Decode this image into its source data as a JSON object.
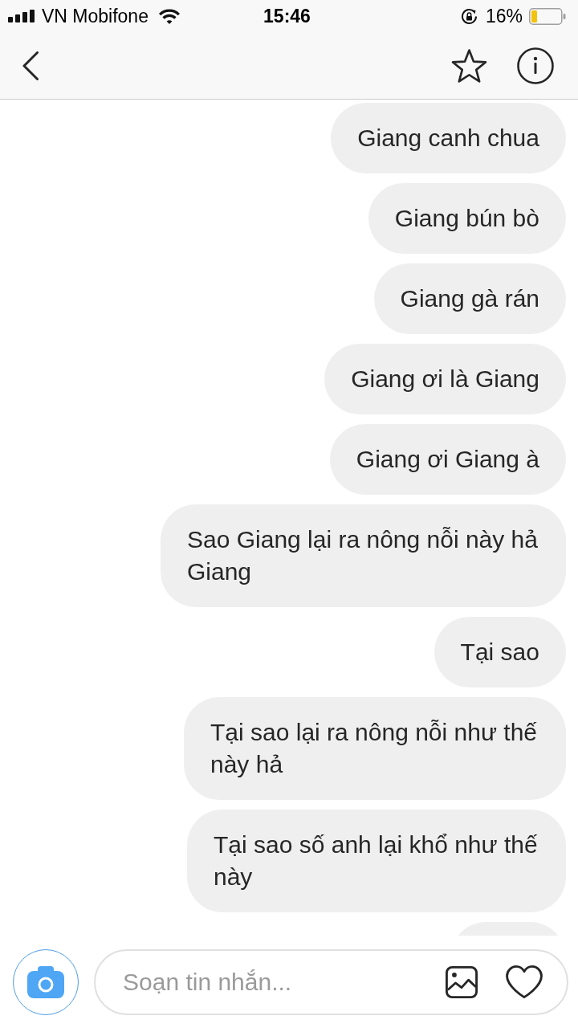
{
  "status_bar": {
    "carrier": "VN Mobifone",
    "time": "15:46",
    "battery_percent": "16%"
  },
  "messages": [
    {
      "kind": "text",
      "text": "Giang canh chua"
    },
    {
      "kind": "text",
      "text": "Giang bún bò"
    },
    {
      "kind": "text",
      "text": "Giang gà rán"
    },
    {
      "kind": "text",
      "text": "Giang ơi là Giang"
    },
    {
      "kind": "text",
      "text": "Giang ơi Giang à"
    },
    {
      "kind": "text",
      "text": "Sao Giang lại ra nông nỗi này hả Giang"
    },
    {
      "kind": "text",
      "text": "Tại sao"
    },
    {
      "kind": "text",
      "text": "Tại sao lại ra nông nỗi như thế này hả"
    },
    {
      "kind": "text",
      "text": "Tại sao số anh lại khổ như thế này"
    },
    {
      "kind": "cut_off"
    }
  ],
  "composer": {
    "placeholder": "Soạn tin nhắn..."
  }
}
